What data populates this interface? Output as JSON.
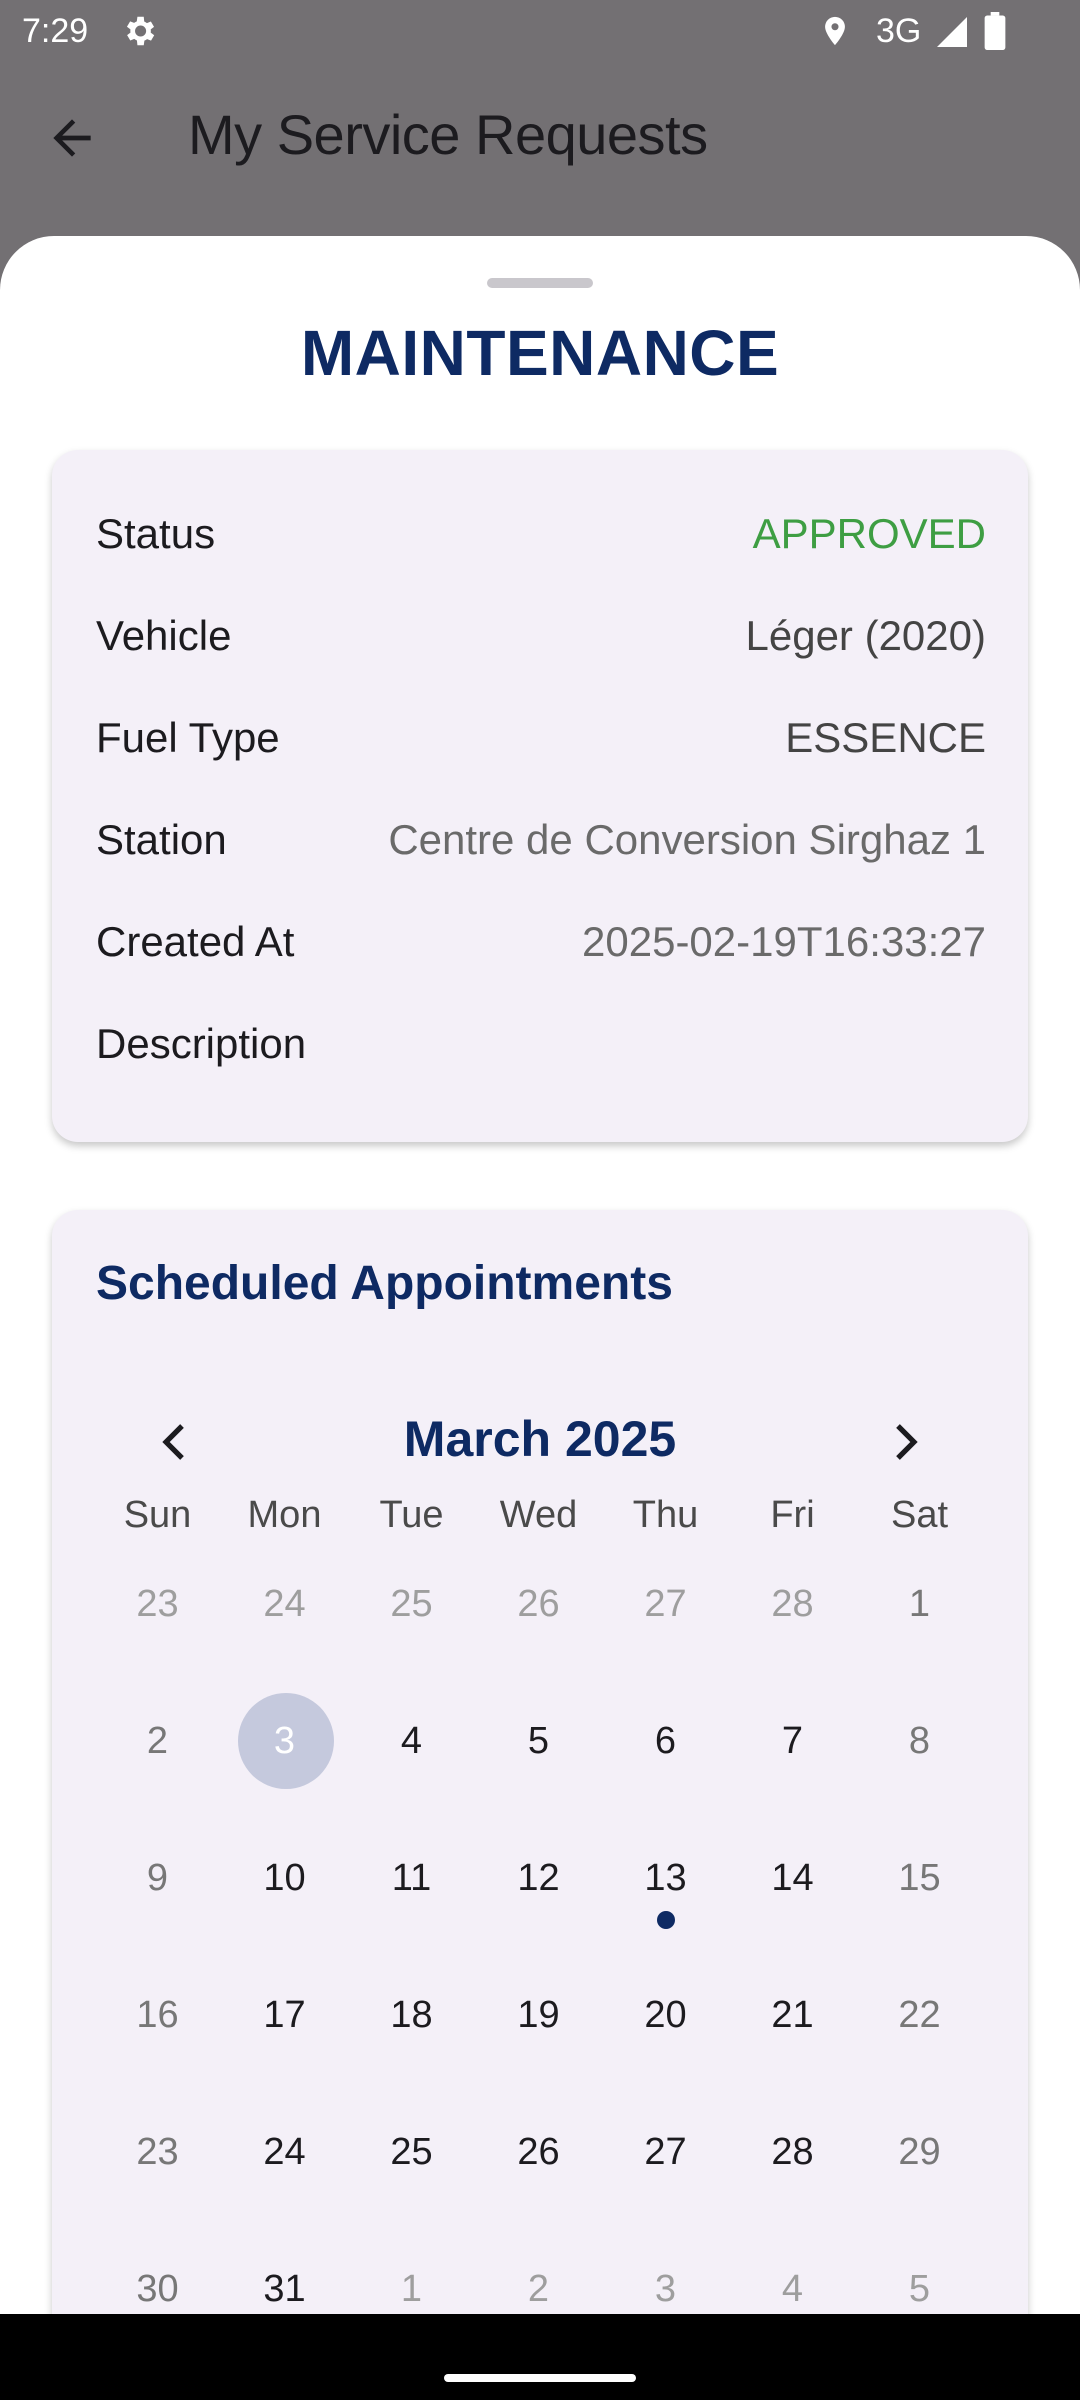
{
  "status_bar": {
    "time": "7:29",
    "network": "3G"
  },
  "app_bar": {
    "title": "My Service Requests"
  },
  "sheet": {
    "title": "MAINTENANCE"
  },
  "details": {
    "rows": [
      {
        "label": "Status",
        "value": "APPROVED"
      },
      {
        "label": "Vehicle",
        "value": "Léger (2020)"
      },
      {
        "label": "Fuel Type",
        "value": "ESSENCE"
      },
      {
        "label": "Station",
        "value": "Centre de Conversion Sirghaz 1"
      },
      {
        "label": "Created At",
        "value": "2025-02-19T16:33:27"
      },
      {
        "label": "Description",
        "value": ""
      }
    ]
  },
  "calendar": {
    "title": "Scheduled Appointments",
    "month": "March 2025",
    "weekdays": [
      "Sun",
      "Mon",
      "Tue",
      "Wed",
      "Thu",
      "Fri",
      "Sat"
    ],
    "weeks": [
      [
        "23",
        "24",
        "25",
        "26",
        "27",
        "28",
        "1"
      ],
      [
        "2",
        "3",
        "4",
        "5",
        "6",
        "7",
        "8"
      ],
      [
        "9",
        "10",
        "11",
        "12",
        "13",
        "14",
        "15"
      ],
      [
        "16",
        "17",
        "18",
        "19",
        "20",
        "21",
        "22"
      ],
      [
        "23",
        "24",
        "25",
        "26",
        "27",
        "28",
        "29"
      ],
      [
        "30",
        "31",
        "1",
        "2",
        "3",
        "4",
        "5"
      ]
    ],
    "selected_day": "3",
    "appointment_days": [
      "13"
    ]
  },
  "colors": {
    "accent": "#0e2a63",
    "approved": "#3e9e43",
    "card_bg": "#f4f0f8",
    "selected_day_bg": "#c5c9dd"
  }
}
